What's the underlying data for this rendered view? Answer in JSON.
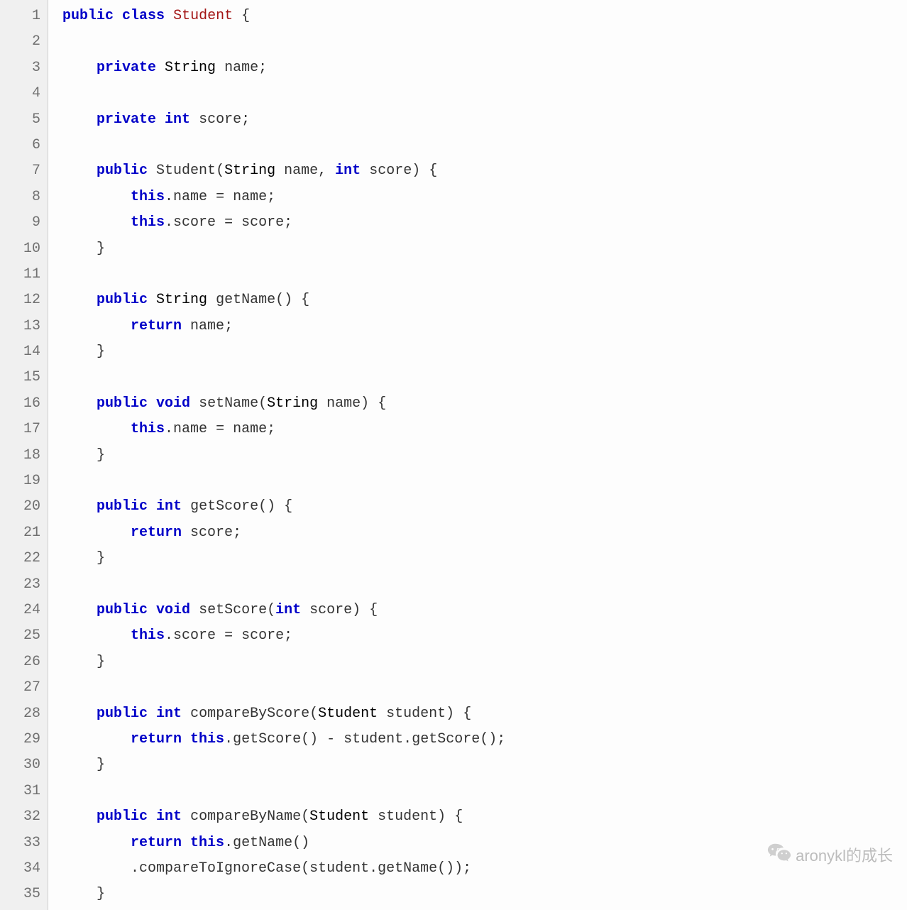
{
  "lineCount": 35,
  "watermark": "aronykl的成长",
  "code": {
    "tokens": [
      [
        [
          "kw",
          "public"
        ],
        [
          "sp",
          " "
        ],
        [
          "kw",
          "class"
        ],
        [
          "sp",
          " "
        ],
        [
          "cls",
          "Student"
        ],
        [
          "sp",
          " "
        ],
        [
          "pun",
          "{"
        ]
      ],
      [],
      [
        [
          "sp",
          "    "
        ],
        [
          "kw",
          "private"
        ],
        [
          "sp",
          " "
        ],
        [
          "type",
          "String"
        ],
        [
          "sp",
          " "
        ],
        [
          "id",
          "name"
        ],
        [
          "pun",
          ";"
        ]
      ],
      [],
      [
        [
          "sp",
          "    "
        ],
        [
          "kw",
          "private"
        ],
        [
          "sp",
          " "
        ],
        [
          "kw",
          "int"
        ],
        [
          "sp",
          " "
        ],
        [
          "id",
          "score"
        ],
        [
          "pun",
          ";"
        ]
      ],
      [],
      [
        [
          "sp",
          "    "
        ],
        [
          "kw",
          "public"
        ],
        [
          "sp",
          " "
        ],
        [
          "id",
          "Student"
        ],
        [
          "pun",
          "("
        ],
        [
          "type",
          "String"
        ],
        [
          "sp",
          " "
        ],
        [
          "id",
          "name"
        ],
        [
          "pun",
          ","
        ],
        [
          "sp",
          " "
        ],
        [
          "kw",
          "int"
        ],
        [
          "sp",
          " "
        ],
        [
          "id",
          "score"
        ],
        [
          "pun",
          ")"
        ],
        [
          "sp",
          " "
        ],
        [
          "pun",
          "{"
        ]
      ],
      [
        [
          "sp",
          "        "
        ],
        [
          "kw",
          "this"
        ],
        [
          "pun",
          "."
        ],
        [
          "id",
          "name"
        ],
        [
          "sp",
          " "
        ],
        [
          "op",
          "="
        ],
        [
          "sp",
          " "
        ],
        [
          "id",
          "name"
        ],
        [
          "pun",
          ";"
        ]
      ],
      [
        [
          "sp",
          "        "
        ],
        [
          "kw",
          "this"
        ],
        [
          "pun",
          "."
        ],
        [
          "id",
          "score"
        ],
        [
          "sp",
          " "
        ],
        [
          "op",
          "="
        ],
        [
          "sp",
          " "
        ],
        [
          "id",
          "score"
        ],
        [
          "pun",
          ";"
        ]
      ],
      [
        [
          "sp",
          "    "
        ],
        [
          "pun",
          "}"
        ]
      ],
      [],
      [
        [
          "sp",
          "    "
        ],
        [
          "kw",
          "public"
        ],
        [
          "sp",
          " "
        ],
        [
          "type",
          "String"
        ],
        [
          "sp",
          " "
        ],
        [
          "id",
          "getName"
        ],
        [
          "pun",
          "()"
        ],
        [
          "sp",
          " "
        ],
        [
          "pun",
          "{"
        ]
      ],
      [
        [
          "sp",
          "        "
        ],
        [
          "kw",
          "return"
        ],
        [
          "sp",
          " "
        ],
        [
          "id",
          "name"
        ],
        [
          "pun",
          ";"
        ]
      ],
      [
        [
          "sp",
          "    "
        ],
        [
          "pun",
          "}"
        ]
      ],
      [],
      [
        [
          "sp",
          "    "
        ],
        [
          "kw",
          "public"
        ],
        [
          "sp",
          " "
        ],
        [
          "kw",
          "void"
        ],
        [
          "sp",
          " "
        ],
        [
          "id",
          "setName"
        ],
        [
          "pun",
          "("
        ],
        [
          "type",
          "String"
        ],
        [
          "sp",
          " "
        ],
        [
          "id",
          "name"
        ],
        [
          "pun",
          ")"
        ],
        [
          "sp",
          " "
        ],
        [
          "pun",
          "{"
        ]
      ],
      [
        [
          "sp",
          "        "
        ],
        [
          "kw",
          "this"
        ],
        [
          "pun",
          "."
        ],
        [
          "id",
          "name"
        ],
        [
          "sp",
          " "
        ],
        [
          "op",
          "="
        ],
        [
          "sp",
          " "
        ],
        [
          "id",
          "name"
        ],
        [
          "pun",
          ";"
        ]
      ],
      [
        [
          "sp",
          "    "
        ],
        [
          "pun",
          "}"
        ]
      ],
      [],
      [
        [
          "sp",
          "    "
        ],
        [
          "kw",
          "public"
        ],
        [
          "sp",
          " "
        ],
        [
          "kw",
          "int"
        ],
        [
          "sp",
          " "
        ],
        [
          "id",
          "getScore"
        ],
        [
          "pun",
          "()"
        ],
        [
          "sp",
          " "
        ],
        [
          "pun",
          "{"
        ]
      ],
      [
        [
          "sp",
          "        "
        ],
        [
          "kw",
          "return"
        ],
        [
          "sp",
          " "
        ],
        [
          "id",
          "score"
        ],
        [
          "pun",
          ";"
        ]
      ],
      [
        [
          "sp",
          "    "
        ],
        [
          "pun",
          "}"
        ]
      ],
      [],
      [
        [
          "sp",
          "    "
        ],
        [
          "kw",
          "public"
        ],
        [
          "sp",
          " "
        ],
        [
          "kw",
          "void"
        ],
        [
          "sp",
          " "
        ],
        [
          "id",
          "setScore"
        ],
        [
          "pun",
          "("
        ],
        [
          "kw",
          "int"
        ],
        [
          "sp",
          " "
        ],
        [
          "id",
          "score"
        ],
        [
          "pun",
          ")"
        ],
        [
          "sp",
          " "
        ],
        [
          "pun",
          "{"
        ]
      ],
      [
        [
          "sp",
          "        "
        ],
        [
          "kw",
          "this"
        ],
        [
          "pun",
          "."
        ],
        [
          "id",
          "score"
        ],
        [
          "sp",
          " "
        ],
        [
          "op",
          "="
        ],
        [
          "sp",
          " "
        ],
        [
          "id",
          "score"
        ],
        [
          "pun",
          ";"
        ]
      ],
      [
        [
          "sp",
          "    "
        ],
        [
          "pun",
          "}"
        ]
      ],
      [],
      [
        [
          "sp",
          "    "
        ],
        [
          "kw",
          "public"
        ],
        [
          "sp",
          " "
        ],
        [
          "kw",
          "int"
        ],
        [
          "sp",
          " "
        ],
        [
          "id",
          "compareByScore"
        ],
        [
          "pun",
          "("
        ],
        [
          "type",
          "Student"
        ],
        [
          "sp",
          " "
        ],
        [
          "id",
          "student"
        ],
        [
          "pun",
          ")"
        ],
        [
          "sp",
          " "
        ],
        [
          "pun",
          "{"
        ]
      ],
      [
        [
          "sp",
          "        "
        ],
        [
          "kw",
          "return"
        ],
        [
          "sp",
          " "
        ],
        [
          "kw",
          "this"
        ],
        [
          "pun",
          "."
        ],
        [
          "id",
          "getScore"
        ],
        [
          "pun",
          "()"
        ],
        [
          "sp",
          " "
        ],
        [
          "op",
          "-"
        ],
        [
          "sp",
          " "
        ],
        [
          "id",
          "student"
        ],
        [
          "pun",
          "."
        ],
        [
          "id",
          "getScore"
        ],
        [
          "pun",
          "();"
        ]
      ],
      [
        [
          "sp",
          "    "
        ],
        [
          "pun",
          "}"
        ]
      ],
      [],
      [
        [
          "sp",
          "    "
        ],
        [
          "kw",
          "public"
        ],
        [
          "sp",
          " "
        ],
        [
          "kw",
          "int"
        ],
        [
          "sp",
          " "
        ],
        [
          "id",
          "compareByName"
        ],
        [
          "pun",
          "("
        ],
        [
          "type",
          "Student"
        ],
        [
          "sp",
          " "
        ],
        [
          "id",
          "student"
        ],
        [
          "pun",
          ")"
        ],
        [
          "sp",
          " "
        ],
        [
          "pun",
          "{"
        ]
      ],
      [
        [
          "sp",
          "        "
        ],
        [
          "kw",
          "return"
        ],
        [
          "sp",
          " "
        ],
        [
          "kw",
          "this"
        ],
        [
          "pun",
          "."
        ],
        [
          "id",
          "getName"
        ],
        [
          "pun",
          "()"
        ]
      ],
      [
        [
          "sp",
          "        "
        ],
        [
          "pun",
          "."
        ],
        [
          "id",
          "compareToIgnoreCase"
        ],
        [
          "pun",
          "("
        ],
        [
          "id",
          "student"
        ],
        [
          "pun",
          "."
        ],
        [
          "id",
          "getName"
        ],
        [
          "pun",
          "());"
        ]
      ],
      [
        [
          "sp",
          "    "
        ],
        [
          "pun",
          "}"
        ]
      ]
    ]
  }
}
